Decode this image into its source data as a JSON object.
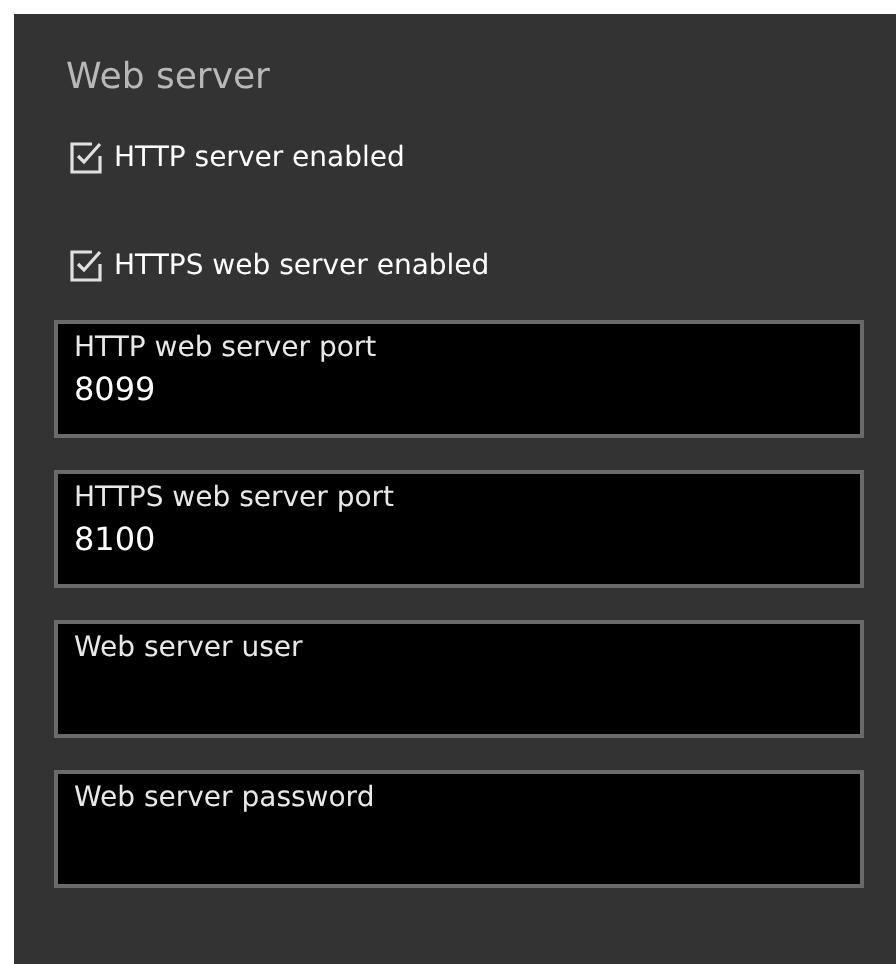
{
  "title": "Web server",
  "checkboxes": [
    {
      "label": "HTTP server enabled",
      "checked": true
    },
    {
      "label": "HTTPS web server enabled",
      "checked": true
    }
  ],
  "fields": [
    {
      "label": "HTTP web server port",
      "value": "8099"
    },
    {
      "label": "HTTPS web server port",
      "value": "8100"
    },
    {
      "label": "Web server user"
    },
    {
      "label": "Web server password"
    }
  ]
}
